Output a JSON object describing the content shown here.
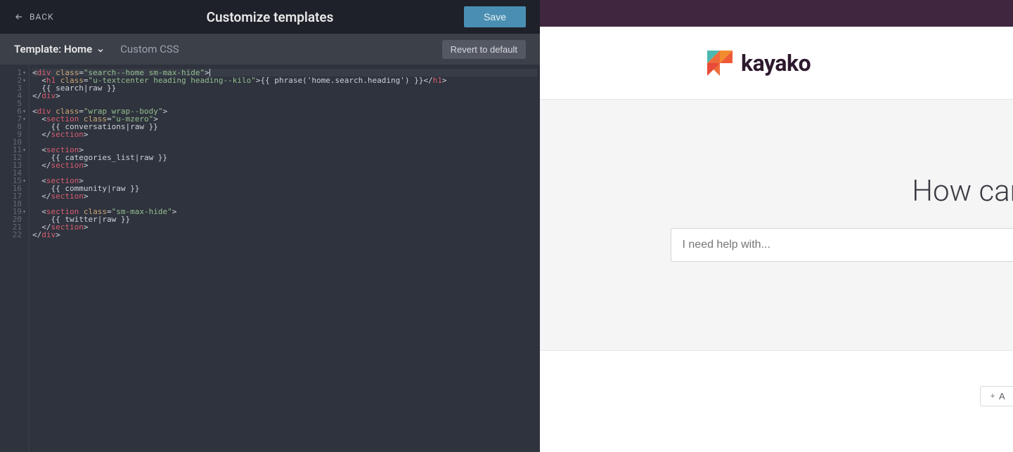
{
  "topbar": {
    "back_label": "BACK",
    "title": "Customize templates",
    "save_label": "Save"
  },
  "subbar": {
    "template_label": "Template: Home",
    "custom_css_label": "Custom CSS",
    "revert_label": "Revert to default"
  },
  "editor": {
    "lines": [
      {
        "n": 1,
        "fold": true,
        "seg": [
          [
            "bracket",
            "<"
          ],
          [
            "tag",
            "div"
          ],
          [
            "text",
            " "
          ],
          [
            "attr",
            "class"
          ],
          [
            "bracket",
            "="
          ],
          [
            "val",
            "\"search--home sm-max-hide\""
          ],
          [
            "bracket",
            ">"
          ]
        ],
        "cursor": true
      },
      {
        "n": 2,
        "fold": true,
        "seg": [
          [
            "text",
            "  "
          ],
          [
            "bracket",
            "<"
          ],
          [
            "tag",
            "h1"
          ],
          [
            "text",
            " "
          ],
          [
            "attr",
            "class"
          ],
          [
            "bracket",
            "="
          ],
          [
            "val",
            "\"u-textcenter heading heading--kilo\""
          ],
          [
            "bracket",
            ">"
          ],
          [
            "text",
            "{{ phrase('home.search.heading') }}"
          ],
          [
            "bracket",
            "</"
          ],
          [
            "tag",
            "h1"
          ],
          [
            "bracket",
            ">"
          ]
        ]
      },
      {
        "n": 3,
        "seg": [
          [
            "text",
            "  {{ search|raw }}"
          ]
        ]
      },
      {
        "n": 4,
        "seg": [
          [
            "bracket",
            "</"
          ],
          [
            "tag",
            "div"
          ],
          [
            "bracket",
            ">"
          ]
        ]
      },
      {
        "n": 5,
        "seg": []
      },
      {
        "n": 6,
        "fold": true,
        "seg": [
          [
            "bracket",
            "<"
          ],
          [
            "tag",
            "div"
          ],
          [
            "text",
            " "
          ],
          [
            "attr",
            "class"
          ],
          [
            "bracket",
            "="
          ],
          [
            "val",
            "\"wrap wrap--body\""
          ],
          [
            "bracket",
            ">"
          ]
        ]
      },
      {
        "n": 7,
        "fold": true,
        "seg": [
          [
            "text",
            "  "
          ],
          [
            "bracket",
            "<"
          ],
          [
            "tag",
            "section"
          ],
          [
            "text",
            " "
          ],
          [
            "attr",
            "class"
          ],
          [
            "bracket",
            "="
          ],
          [
            "val",
            "\"u-mzero\""
          ],
          [
            "bracket",
            ">"
          ]
        ]
      },
      {
        "n": 8,
        "seg": [
          [
            "text",
            "    {{ conversations|raw }}"
          ]
        ]
      },
      {
        "n": 9,
        "seg": [
          [
            "text",
            "  "
          ],
          [
            "bracket",
            "</"
          ],
          [
            "tag",
            "section"
          ],
          [
            "bracket",
            ">"
          ]
        ]
      },
      {
        "n": 10,
        "seg": []
      },
      {
        "n": 11,
        "fold": true,
        "seg": [
          [
            "text",
            "  "
          ],
          [
            "bracket",
            "<"
          ],
          [
            "tag",
            "section"
          ],
          [
            "bracket",
            ">"
          ]
        ]
      },
      {
        "n": 12,
        "seg": [
          [
            "text",
            "    {{ categories_list|raw }}"
          ]
        ]
      },
      {
        "n": 13,
        "seg": [
          [
            "text",
            "  "
          ],
          [
            "bracket",
            "</"
          ],
          [
            "tag",
            "section"
          ],
          [
            "bracket",
            ">"
          ]
        ]
      },
      {
        "n": 14,
        "seg": []
      },
      {
        "n": 15,
        "fold": true,
        "seg": [
          [
            "text",
            "  "
          ],
          [
            "bracket",
            "<"
          ],
          [
            "tag",
            "section"
          ],
          [
            "bracket",
            ">"
          ]
        ]
      },
      {
        "n": 16,
        "seg": [
          [
            "text",
            "    {{ community|raw }}"
          ]
        ]
      },
      {
        "n": 17,
        "seg": [
          [
            "text",
            "  "
          ],
          [
            "bracket",
            "</"
          ],
          [
            "tag",
            "section"
          ],
          [
            "bracket",
            ">"
          ]
        ]
      },
      {
        "n": 18,
        "seg": []
      },
      {
        "n": 19,
        "fold": true,
        "seg": [
          [
            "text",
            "  "
          ],
          [
            "bracket",
            "<"
          ],
          [
            "tag",
            "section"
          ],
          [
            "text",
            " "
          ],
          [
            "attr",
            "class"
          ],
          [
            "bracket",
            "="
          ],
          [
            "val",
            "\"sm-max-hide\""
          ],
          [
            "bracket",
            ">"
          ]
        ]
      },
      {
        "n": 20,
        "seg": [
          [
            "text",
            "    {{ twitter|raw }}"
          ]
        ]
      },
      {
        "n": 21,
        "seg": [
          [
            "text",
            "  "
          ],
          [
            "bracket",
            "</"
          ],
          [
            "tag",
            "section"
          ],
          [
            "bracket",
            ">"
          ]
        ]
      },
      {
        "n": 22,
        "seg": [
          [
            "bracket",
            "</"
          ],
          [
            "tag",
            "div"
          ],
          [
            "bracket",
            ">"
          ]
        ]
      }
    ]
  },
  "preview": {
    "logo_text": "kayako",
    "hero_heading": "How can",
    "search_placeholder": "I need help with...",
    "add_label": "A"
  }
}
